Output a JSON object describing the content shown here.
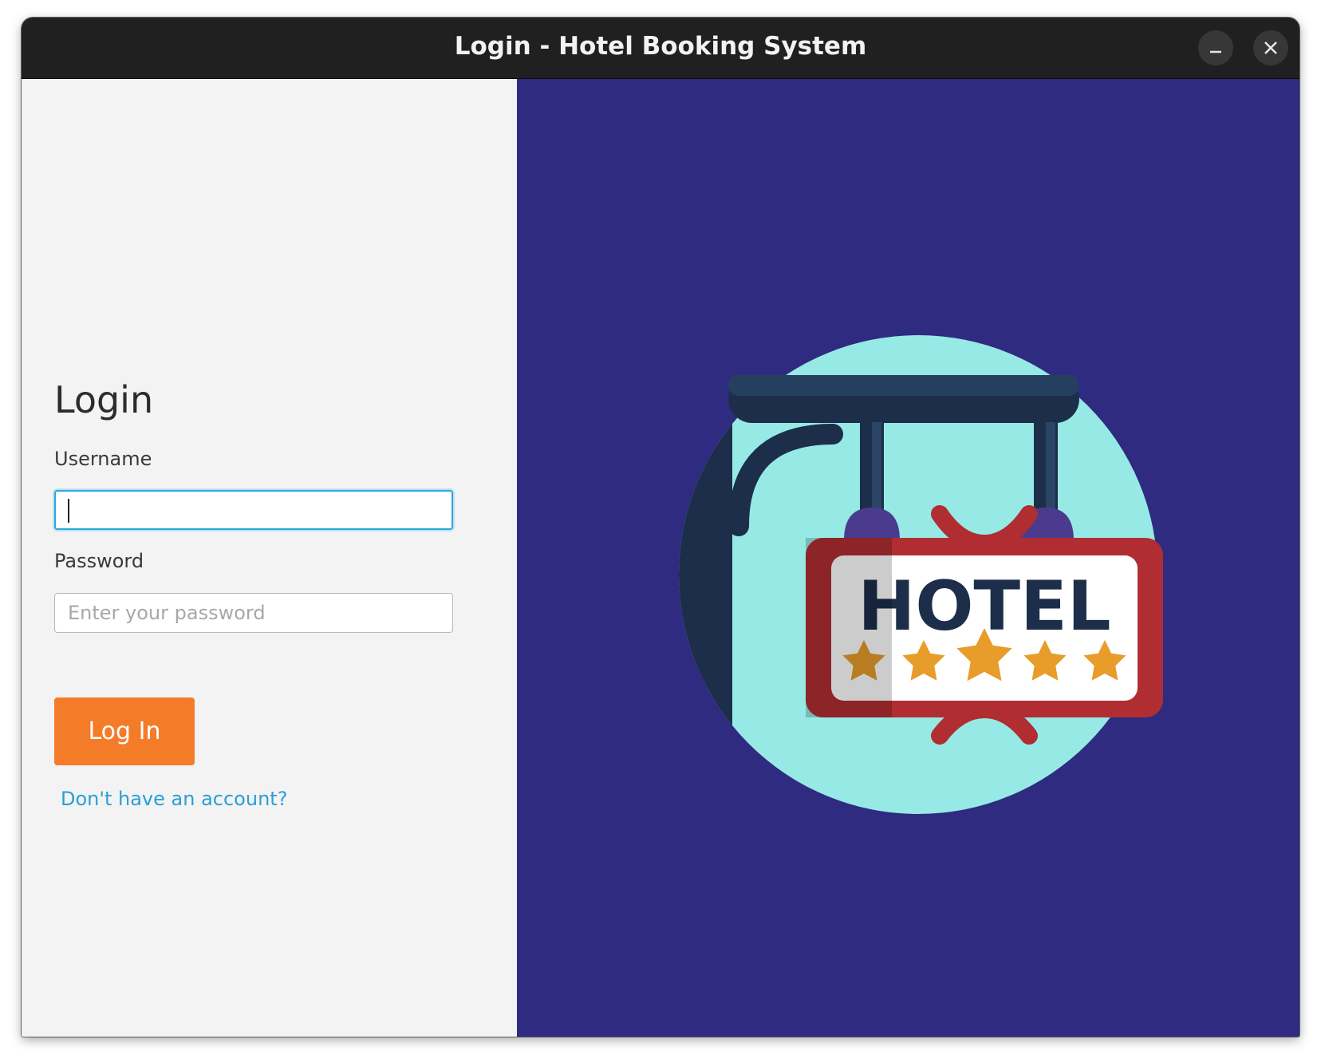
{
  "window": {
    "title": "Login - Hotel Booking System"
  },
  "form": {
    "heading": "Login",
    "username_label": "Username",
    "username_value": "",
    "password_label": "Password",
    "password_placeholder": "Enter your password",
    "login_button": "Log In",
    "signup_link": "Don't have an account?"
  },
  "illustration": {
    "sign_text": "HOTEL",
    "stars": 5
  },
  "colors": {
    "titlebar": "#202020",
    "left_panel": "#f3f3f3",
    "right_panel": "#2e2b80",
    "accent_button": "#f47c29",
    "link": "#2a9fd6",
    "focus_border": "#29a8e0"
  }
}
